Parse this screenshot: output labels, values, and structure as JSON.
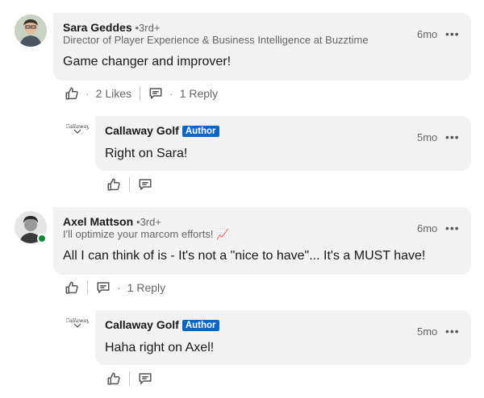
{
  "comments": [
    {
      "author": "Sara Geddes",
      "degree": "•3rd+",
      "headline": "Director of Player Experience & Business Intelligence at Buzztime",
      "time": "6mo",
      "text": "Game changer and improver!",
      "likes": "2 Likes",
      "replies": "1 Reply"
    },
    {
      "author": "Callaway Golf",
      "badge": "Author",
      "time": "5mo",
      "text": "Right on Sara!",
      "logo": "Callaway"
    },
    {
      "author": "Axel Mattson",
      "degree": "•3rd+",
      "headline": "I'll optimize your marcom efforts! 📈",
      "time": "6mo",
      "text": "All I can think of is - It's not a \"nice to have\"... It's a MUST have!",
      "replies": "1 Reply"
    },
    {
      "author": "Callaway Golf",
      "badge": "Author",
      "time": "5mo",
      "text": "Haha right on Axel!",
      "logo": "Callaway"
    }
  ],
  "icons": {
    "like": "thumbs-up-icon",
    "reply": "comment-icon",
    "more": "more-options-icon"
  },
  "colors": {
    "bubble": "#f2f2f2",
    "author_badge": "#0a66c2",
    "online": "#0a8a3a"
  }
}
